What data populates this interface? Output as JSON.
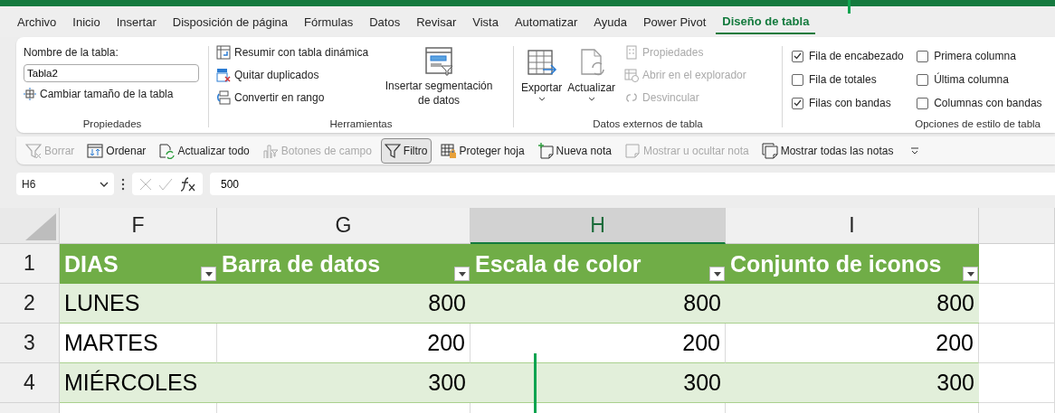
{
  "menu_tabs": [
    {
      "label": "Archivo",
      "selected": false
    },
    {
      "label": "Inicio",
      "selected": false
    },
    {
      "label": "Insertar",
      "selected": false
    },
    {
      "label": "Disposición de página",
      "selected": false
    },
    {
      "label": "Fórmulas",
      "selected": false
    },
    {
      "label": "Datos",
      "selected": false
    },
    {
      "label": "Revisar",
      "selected": false
    },
    {
      "label": "Vista",
      "selected": false
    },
    {
      "label": "Automatizar",
      "selected": false
    },
    {
      "label": "Ayuda",
      "selected": false
    },
    {
      "label": "Power Pivot",
      "selected": false
    },
    {
      "label": "Diseño de tabla",
      "selected": true
    }
  ],
  "ribbon": {
    "properties": {
      "label": "Propiedades",
      "name_label": "Nombre de la tabla:",
      "name_value": "Tabla2",
      "resize": "Cambiar tamaño de la tabla"
    },
    "tools": {
      "label": "Herramientas",
      "items": [
        {
          "label": "Resumir con tabla dinámica",
          "disabled": false
        },
        {
          "label": "Quitar duplicados",
          "disabled": false
        },
        {
          "label": "Convertir en rango",
          "disabled": false
        }
      ],
      "slicer": "Insertar segmentación de datos"
    },
    "external": {
      "label": "Datos externos de tabla",
      "export": "Exportar",
      "refresh": "Actualizar",
      "items": [
        {
          "label": "Propiedades",
          "disabled": true
        },
        {
          "label": "Abrir en el explorador",
          "disabled": true
        },
        {
          "label": "Desvincular",
          "disabled": true
        }
      ]
    },
    "style_options": {
      "label": "Opciones de estilo de tabla",
      "options": [
        {
          "label": "Fila de encabezado",
          "checked": true
        },
        {
          "label": "Fila de totales",
          "checked": false
        },
        {
          "label": "Filas con bandas",
          "checked": true
        },
        {
          "label": "Primera columna",
          "checked": false
        },
        {
          "label": "Última columna",
          "checked": false
        },
        {
          "label": "Columnas con bandas",
          "checked": false
        }
      ]
    }
  },
  "quick_toolbar": [
    {
      "label": "Borrar",
      "disabled": true,
      "selected": false
    },
    {
      "label": "Ordenar",
      "disabled": false,
      "selected": false
    },
    {
      "label": "Actualizar todo",
      "disabled": false,
      "selected": false
    },
    {
      "label": "Botones de campo",
      "disabled": true,
      "selected": false
    },
    {
      "label": "Filtro",
      "disabled": false,
      "selected": true
    },
    {
      "label": "Proteger hoja",
      "disabled": false,
      "selected": false
    },
    {
      "label": "Nueva nota",
      "disabled": false,
      "selected": false
    },
    {
      "label": "Mostrar u ocultar nota",
      "disabled": true,
      "selected": false
    },
    {
      "label": "Mostrar todas las notas",
      "disabled": false,
      "selected": false
    }
  ],
  "formula_bar": {
    "name_box": "H6",
    "formula": "500"
  },
  "sheet": {
    "columns": [
      {
        "label": "F",
        "selected": false
      },
      {
        "label": "G",
        "selected": false
      },
      {
        "label": "H",
        "selected": true
      },
      {
        "label": "I",
        "selected": false
      }
    ],
    "rows": [
      {
        "header": "1",
        "cells": [
          "DIAS",
          "Barra de datos",
          "Escala de color",
          "Conjunto de iconos"
        ]
      },
      {
        "header": "2",
        "cells": [
          "LUNES",
          "800",
          "800",
          "800"
        ]
      },
      {
        "header": "3",
        "cells": [
          "MARTES",
          "200",
          "200",
          "200"
        ]
      },
      {
        "header": "4",
        "cells": [
          "MIÉRCOLES",
          "300",
          "300",
          "300"
        ]
      }
    ]
  }
}
